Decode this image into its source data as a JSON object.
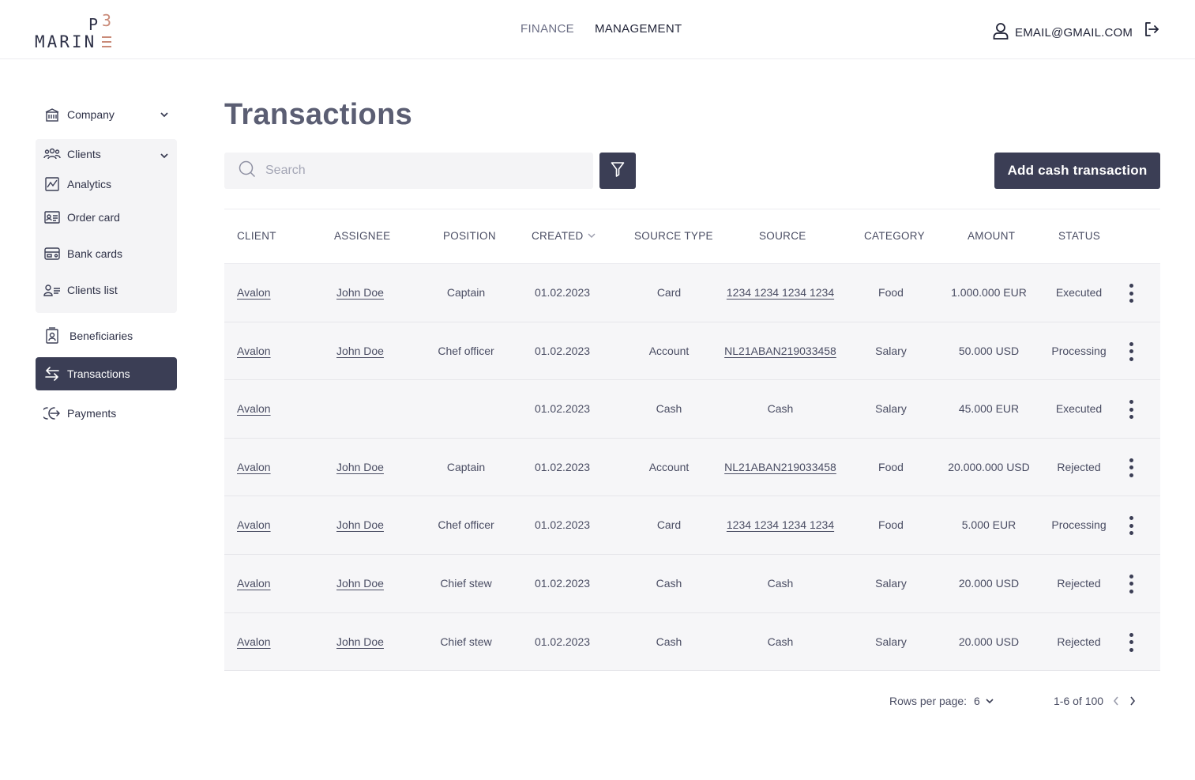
{
  "header": {
    "logo": {
      "p": "P",
      "three": "3",
      "word": "MARIN"
    },
    "nav": [
      {
        "label": "FINANCE",
        "active": false
      },
      {
        "label": "MANAGEMENT",
        "active": true
      }
    ],
    "user_email": "EMAIL@GMAIL.COM"
  },
  "sidebar": {
    "company": "Company",
    "clients": "Clients",
    "client_items": [
      "Analytics",
      "Order card",
      "Bank cards",
      "Clients list"
    ],
    "beneficiaries": "Beneficiaries",
    "transactions": "Transactions",
    "payments": "Payments"
  },
  "main": {
    "title": "Transactions",
    "search_placeholder": "Search",
    "add_button": "Add cash transaction"
  },
  "table": {
    "headers": [
      "CLIENT",
      "ASSIGNEE",
      "POSITION",
      "CREATED",
      "SOURCE TYPE",
      "SOURCE",
      "CATEGORY",
      "AMOUNT",
      "STATUS"
    ],
    "rows": [
      [
        "Avalon",
        "John Doe",
        "Captain",
        "01.02.2023",
        "Card",
        "1234 1234 1234 1234",
        "Food",
        "1.000.000 EUR",
        "Executed"
      ],
      [
        "Avalon",
        "John Doe",
        "Chef officer",
        "01.02.2023",
        "Account",
        "NL21ABAN219033458",
        "Salary",
        "50.000 USD",
        "Processing"
      ],
      [
        "Avalon",
        "",
        "",
        "01.02.2023",
        "Cash",
        "Cash",
        "Salary",
        "45.000 EUR",
        "Executed"
      ],
      [
        "Avalon",
        "John Doe",
        "Captain",
        "01.02.2023",
        "Account",
        "NL21ABAN219033458",
        "Food",
        "20.000.000 USD",
        "Rejected"
      ],
      [
        "Avalon",
        "John Doe",
        "Chef officer",
        "01.02.2023",
        "Card",
        "1234 1234 1234 1234",
        "Food",
        "5.000 EUR",
        "Processing"
      ],
      [
        "Avalon",
        "John Doe",
        "Chief stew",
        "01.02.2023",
        "Cash",
        "Cash",
        "Salary",
        "20.000 USD",
        "Rejected"
      ],
      [
        "Avalon",
        "John Doe",
        "Chief stew",
        "01.02.2023",
        "Cash",
        "Cash",
        "Salary",
        "20.000 USD",
        "Rejected"
      ]
    ]
  },
  "pagination": {
    "rows_per_page_label": "Rows per page:",
    "rows_per_page": "6",
    "range": "1-6 of 100"
  }
}
